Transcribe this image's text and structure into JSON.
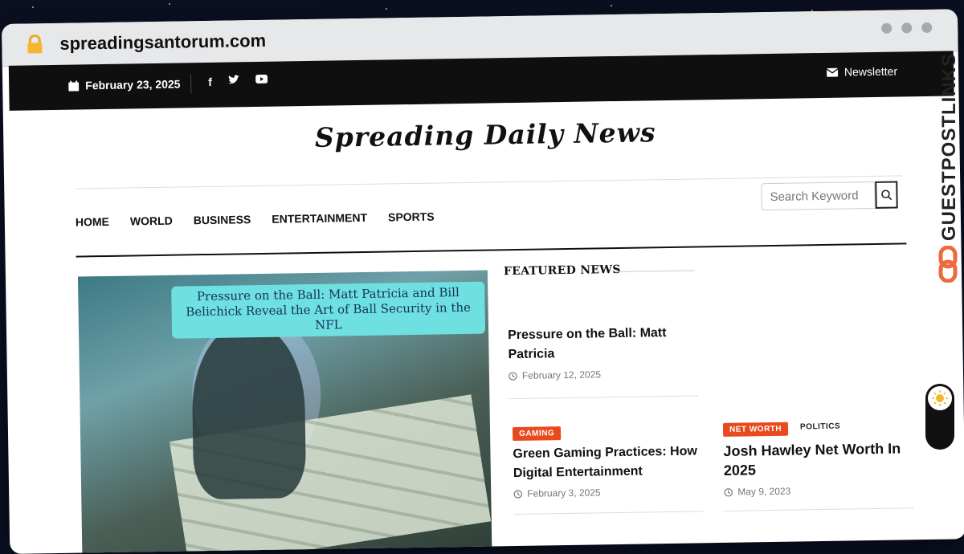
{
  "browser": {
    "url": "spreadingsantorum.com"
  },
  "topbar": {
    "date": "February 23, 2025",
    "social": [
      "f",
      "t",
      "yt"
    ],
    "newsletter_label": "Newsletter"
  },
  "site": {
    "title": "Spreading Daily News"
  },
  "nav": {
    "items": [
      "HOME",
      "WORLD",
      "BUSINESS",
      "ENTERTAINMENT",
      "SPORTS"
    ]
  },
  "search": {
    "placeholder": "Search Keyword"
  },
  "hero": {
    "caption": "Pressure on the Ball: Matt Patricia and Bill Belichick Reveal the Art of Ball Security in the NFL"
  },
  "featured": {
    "heading": "FEATURED NEWS",
    "articles": [
      {
        "title": "Pressure on the Ball: Matt Patricia",
        "date": "February 12, 2025"
      },
      {
        "badge": "GAMING",
        "title": "Green Gaming Practices: How Digital Entertainment",
        "date": "February 3, 2025"
      },
      {
        "badge": "NET WORTH",
        "category": "POLITICS",
        "title": "Josh Hawley Net Worth In 2025",
        "date": "May 9, 2023"
      }
    ]
  },
  "overlay": {
    "brand": "GUESTPOSTLINKS"
  },
  "colors": {
    "accent": "#e84a1e",
    "topbar": "#0f0f0f",
    "caption_bg": "#6fe0e0"
  }
}
